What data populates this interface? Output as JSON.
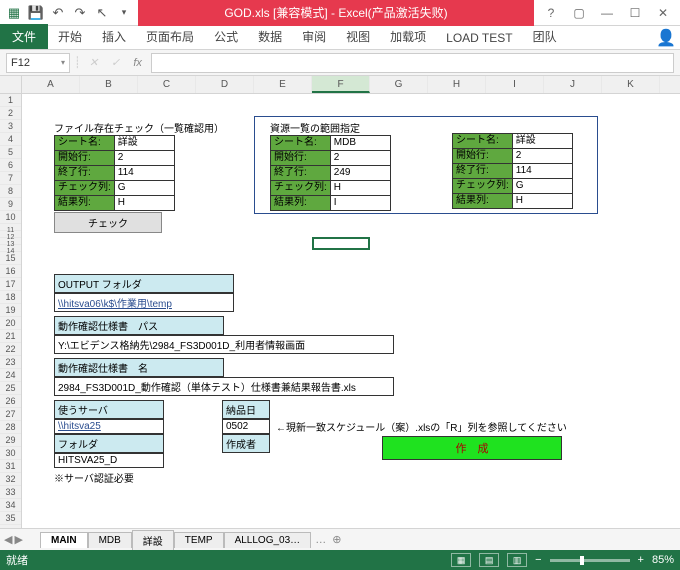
{
  "titlebar": {
    "title": "GOD.xls  [兼容模式]  -  Excel(产品激活失败)"
  },
  "ribbon": {
    "file": "文件",
    "tabs": [
      "开始",
      "插入",
      "页面布局",
      "公式",
      "数据",
      "审阅",
      "视图",
      "加载项",
      "LOAD TEST",
      "团队"
    ]
  },
  "namebox": "F12",
  "sheet_tabs": [
    "MAIN",
    "MDB",
    "詳設",
    "TEMP",
    "ALLLOG_03…"
  ],
  "active_sheet": 0,
  "status": {
    "ready": "就绪",
    "zoom": "85%"
  },
  "sec1": {
    "title": "ファイル存在チェック（一覧確認用）",
    "rows": [
      [
        "シート名:",
        "詳設"
      ],
      [
        "開始行:",
        "2"
      ],
      [
        "終了行:",
        "114"
      ],
      [
        "チェック列:",
        "G"
      ],
      [
        "結果列:",
        "H"
      ]
    ],
    "btn": "チェック"
  },
  "sec2": {
    "title": "資源一覧の範囲指定",
    "rows": [
      [
        "シート名:",
        "MDB"
      ],
      [
        "開始行:",
        "2"
      ],
      [
        "終了行:",
        "249"
      ],
      [
        "チェック列:",
        "H"
      ],
      [
        "結果列:",
        "I"
      ]
    ]
  },
  "sec3": {
    "rows": [
      [
        "シート名:",
        "詳設"
      ],
      [
        "開始行:",
        "2"
      ],
      [
        "終了行:",
        "114"
      ],
      [
        "チェック列:",
        "G"
      ],
      [
        "結果列:",
        "H"
      ]
    ]
  },
  "output": {
    "label": "OUTPUT フォルダ",
    "path": "\\\\hitsva06\\k$\\作業用\\temp"
  },
  "docpath": {
    "label": "動作確認仕様書　パス",
    "path": "Y:\\エビデンス格納先\\2984_FS3D001D_利用者情報画面"
  },
  "docname": {
    "label": "動作確認仕様書　名",
    "name": "2984_FS3D001D_動作確認（単体テスト）仕様書兼結果報告書.xls"
  },
  "server": {
    "label": "使うサーバ",
    "host": "\\\\hitsva25",
    "folder_label": "フォルダ",
    "folder": "HITSVA25_D",
    "note": "※サーバ認証必要"
  },
  "deliver": {
    "date_label": "納品日",
    "date": "0502",
    "author_label": "作成者",
    "arrow_note": "←現新一致スケジュール（案）.xlsの「R」列を参照してください",
    "make_btn": "作　成"
  },
  "columns": [
    "A",
    "B",
    "C",
    "D",
    "E",
    "F",
    "G",
    "H",
    "I",
    "J",
    "K"
  ],
  "rowcount": 35
}
